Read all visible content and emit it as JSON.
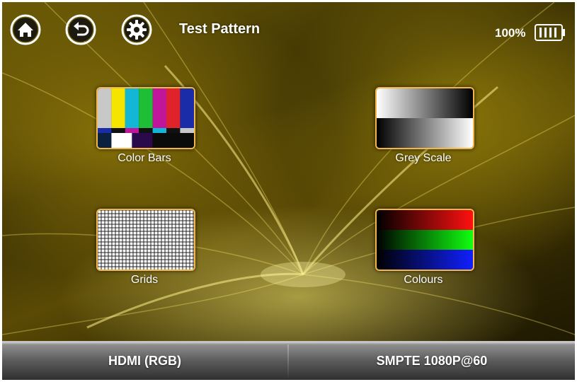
{
  "header": {
    "title": "Test Pattern",
    "icons": [
      {
        "name": "home-icon"
      },
      {
        "name": "back-icon"
      },
      {
        "name": "settings-icon"
      }
    ],
    "battery": {
      "percent_label": "100%",
      "level": 1.0
    }
  },
  "tiles": [
    {
      "label": "Color Bars"
    },
    {
      "label": "Grey Scale"
    },
    {
      "label": "Grids"
    },
    {
      "label": "Colours"
    }
  ],
  "footer": {
    "left_label": "HDMI (RGB)",
    "right_label": "SMPTE 1080P@60"
  },
  "colors": {
    "accent_border": "#f3b64a",
    "background": "#4a3d04"
  }
}
